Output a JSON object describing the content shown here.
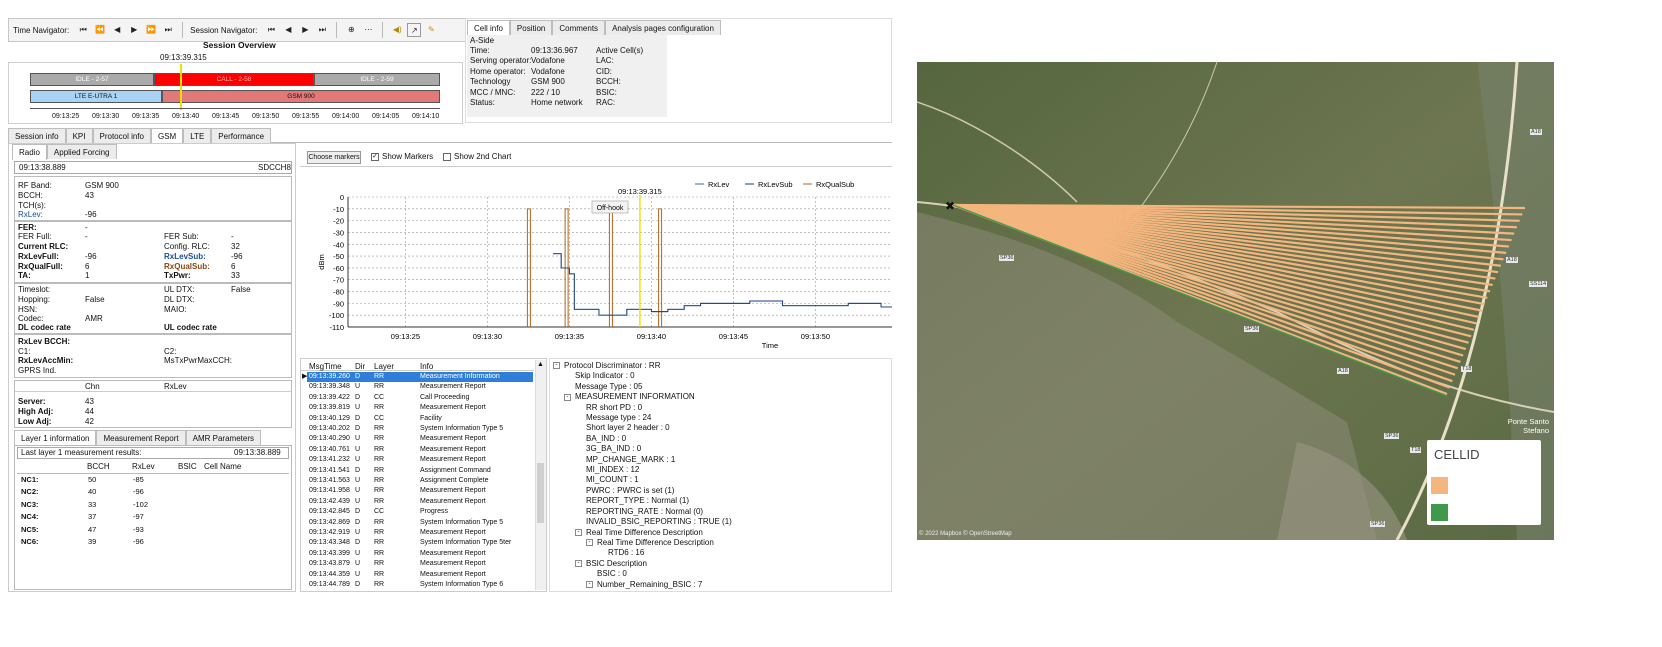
{
  "toolbar": {
    "time_nav_label": "Time Navigator:",
    "session_nav_label": "Session Navigator:",
    "time_nav_icons": [
      "⏮",
      "⏪",
      "◀",
      "▶",
      "⏩",
      "⏭"
    ],
    "session_nav_icons": [
      "⏮",
      "◀",
      "▶",
      "⏭"
    ]
  },
  "session_overview": {
    "title": "Session Overview",
    "cursor_time": "09:13:39.315",
    "segments_row1": [
      "IDLE - 2-57",
      "CALL - 2-58",
      "IDLE - 2-59"
    ],
    "segments_row2": [
      "LTE E-UTRA 1",
      "GSM 900"
    ],
    "axis_ticks": [
      "09:13:25",
      "09:13:30",
      "09:13:35",
      "09:13:40",
      "09:13:45",
      "09:13:50",
      "09:13:55",
      "09:14:00",
      "09:14:05",
      "09:14:10"
    ]
  },
  "cell_info": {
    "tabs": [
      "Cell info",
      "Position",
      "Comments",
      "Analysis pages configuration"
    ],
    "side": "A-Side",
    "rows": [
      [
        "Time:",
        "09:13:36.967",
        "Active Cell(s)"
      ],
      [
        "Serving operator:",
        "Vodafone",
        "LAC:"
      ],
      [
        "Home operator:",
        "Vodafone",
        "CID:"
      ],
      [
        "Technology",
        "GSM 900",
        "BCCH:"
      ],
      [
        "MCC / MNC:",
        "222 / 10",
        "BSIC:"
      ],
      [
        "Status:",
        "Home network",
        "RAC:"
      ]
    ]
  },
  "main_tabs": [
    "Session info",
    "KPI",
    "Protocol info",
    "GSM",
    "LTE",
    "Performance"
  ],
  "sub_tabs": [
    "Radio",
    "Applied Forcing"
  ],
  "radio": {
    "time": "09:13:38.889",
    "channel": "SDCCH8",
    "rf_band_label": "RF Band:",
    "rf_band": "GSM 900",
    "bcch_label": "BCCH:",
    "bcch": "43",
    "tch_label": "TCH(s):",
    "rxlev_label": "RxLev:",
    "rxlev": "-96",
    "fer_label": "FER:",
    "fer": "-",
    "fer_full_label": "FER Full:",
    "fer_full": "-",
    "fer_sub_label": "FER Sub:",
    "fer_sub": "-",
    "current_rlc_label": "Current RLC:",
    "config_rlc_label": "Config. RLC:",
    "config_rlc": "32",
    "rxlevfull_label": "RxLevFull:",
    "rxlevfull": "-96",
    "rxlevsub_label": "RxLevSub:",
    "rxlevsub": "-96",
    "rxqualfull_label": "RxQualFull:",
    "rxqualfull": "6",
    "rxqualsub_label": "RxQualSub:",
    "rxqualsub": "6",
    "ta_label": "TA:",
    "ta": "1",
    "txpwr_label": "TxPwr:",
    "txpwr": "33",
    "timeslot_label": "Timeslot:",
    "ul_dtx_label": "UL DTX:",
    "ul_dtx": "False",
    "hopping_label": "Hopping:",
    "hopping": "False",
    "dl_dtx_label": "DL DTX:",
    "hsn_label": "HSN:",
    "maio_label": "MAIO:",
    "codec_label": "Codec:",
    "codec": "AMR",
    "dl_codec_label": "DL codec rate",
    "ul_codec_label": "UL codec rate",
    "rxlev_bcch_label": "RxLev BCCH:",
    "c1_label": "C1:",
    "c2_label": "C2:",
    "rxlevaccmin_label": "RxLevAccMin:",
    "mstxpwr_label": "MsTxPwrMaxCCH:",
    "gprs_label": "GPRS Ind.",
    "chn_header": "Chn",
    "rxlev_header": "RxLev",
    "server_label": "Server:",
    "server": "43",
    "high_adj_label": "High Adj:",
    "high_adj": "44",
    "low_adj_label": "Low Adj:",
    "low_adj": "42"
  },
  "l1_tabs": [
    "Layer 1 information",
    "Measurement Report",
    "AMR Parameters"
  ],
  "l1": {
    "title": "Last layer 1 measurement results:",
    "time": "09:13:38.889",
    "headers": [
      "",
      "BCCH",
      "RxLev",
      "BSIC",
      "Cell Name"
    ],
    "rows": [
      [
        "NC1:",
        "50",
        "-85"
      ],
      [
        "NC2:",
        "40",
        "-96"
      ],
      [
        "NC3:",
        "33",
        "-102"
      ],
      [
        "NC4:",
        "37",
        "-97"
      ],
      [
        "NC5:",
        "47",
        "-93"
      ],
      [
        "NC6:",
        "39",
        "-96"
      ]
    ]
  },
  "chart_controls": {
    "choose_markers": "Choose markers",
    "show_markers": "Show Markers",
    "show_2nd": "Show 2nd Chart"
  },
  "chart_data": {
    "type": "line",
    "title": "",
    "xlabel": "Time",
    "ylabel": "dBm",
    "ylim": [
      -110,
      0
    ],
    "yticks": [
      0,
      -10,
      -20,
      -30,
      -40,
      -50,
      -60,
      -70,
      -80,
      -90,
      -100,
      -110
    ],
    "xticks": [
      "09:13:25",
      "09:13:30",
      "09:13:35",
      "09:13:40",
      "09:13:45",
      "09:13:50"
    ],
    "xrange_seconds": [
      0,
      37
    ],
    "cursor_time": "09:13:39.315",
    "marker_label": "Off-hook",
    "grid": true,
    "legend_position": "top-right",
    "series": [
      {
        "name": "RxLev",
        "color": "#2e6fb5",
        "points": [
          [
            34,
            -48
          ],
          [
            34.5,
            -60
          ],
          [
            35,
            -65
          ],
          [
            35.3,
            -95
          ],
          [
            36.5,
            -95
          ],
          [
            36.8,
            -100
          ],
          [
            38,
            -100
          ],
          [
            38.5,
            -95
          ],
          [
            40,
            -97
          ],
          [
            41,
            -95
          ],
          [
            42,
            -92
          ],
          [
            43,
            -90
          ],
          [
            46,
            -88
          ],
          [
            48,
            -92
          ],
          [
            52,
            -90
          ],
          [
            54,
            -93
          ],
          [
            56,
            -90
          ]
        ]
      },
      {
        "name": "RxLevSub",
        "color": "#1a3f80",
        "points": [
          [
            34,
            -48
          ],
          [
            34.5,
            -60
          ],
          [
            35,
            -65
          ],
          [
            35.3,
            -95
          ],
          [
            36.5,
            -95
          ],
          [
            36.8,
            -100
          ],
          [
            38,
            -100
          ],
          [
            38.5,
            -95
          ],
          [
            40,
            -97
          ],
          [
            41,
            -95
          ],
          [
            42,
            -92
          ],
          [
            43,
            -90
          ],
          [
            46,
            -88
          ],
          [
            48,
            -92
          ],
          [
            52,
            -90
          ],
          [
            54,
            -93
          ],
          [
            56,
            -90
          ]
        ]
      },
      {
        "name": "RxQualSub",
        "color": "#b5651d",
        "spikes": [
          [
            32.5,
            -10
          ],
          [
            34.8,
            -10
          ],
          [
            37.5,
            -10
          ],
          [
            40.5,
            -10
          ]
        ]
      }
    ]
  },
  "log_table": {
    "headers": [
      "MsgTime",
      "Dir",
      "Layer",
      "Info"
    ],
    "rows": [
      [
        "09:13:39.260",
        "D",
        "RR",
        "Measurement Information"
      ],
      [
        "09:13:39.348",
        "U",
        "RR",
        "Measurement Report"
      ],
      [
        "09:13:39.422",
        "D",
        "CC",
        "Call Proceeding"
      ],
      [
        "09:13:39.819",
        "U",
        "RR",
        "Measurement Report"
      ],
      [
        "09:13:40.129",
        "D",
        "CC",
        "Facility"
      ],
      [
        "09:13:40.202",
        "D",
        "RR",
        "System Information Type 5"
      ],
      [
        "09:13:40.290",
        "U",
        "RR",
        "Measurement Report"
      ],
      [
        "09:13:40.761",
        "U",
        "RR",
        "Measurement Report"
      ],
      [
        "09:13:41.232",
        "U",
        "RR",
        "Measurement Report"
      ],
      [
        "09:13:41.541",
        "D",
        "RR",
        "Assignment Command"
      ],
      [
        "09:13:41.563",
        "U",
        "RR",
        "Assignment Complete"
      ],
      [
        "09:13:41.958",
        "U",
        "RR",
        "Measurement Report"
      ],
      [
        "09:13:42.439",
        "U",
        "RR",
        "Measurement Report"
      ],
      [
        "09:13:42.845",
        "D",
        "CC",
        "Progress"
      ],
      [
        "09:13:42.869",
        "D",
        "RR",
        "System Information Type 5"
      ],
      [
        "09:13:42.919",
        "U",
        "RR",
        "Measurement Report"
      ],
      [
        "09:13:43.348",
        "D",
        "RR",
        "System Information Type 5ter"
      ],
      [
        "09:13:43.399",
        "U",
        "RR",
        "Measurement Report"
      ],
      [
        "09:13:43.879",
        "U",
        "RR",
        "Measurement Report"
      ],
      [
        "09:13:44.359",
        "U",
        "RR",
        "Measurement Report"
      ],
      [
        "09:13:44.789",
        "D",
        "RR",
        "System Information Type 6"
      ]
    ]
  },
  "decode_tree": [
    {
      "indent": 0,
      "toggle": "-",
      "text": "Protocol Discriminator : RR"
    },
    {
      "indent": 1,
      "toggle": "",
      "text": "Skip Indicator : 0"
    },
    {
      "indent": 1,
      "toggle": "",
      "text": "Message Type : 05"
    },
    {
      "indent": 1,
      "toggle": "-",
      "text": "MEASUREMENT INFORMATION"
    },
    {
      "indent": 2,
      "toggle": "",
      "text": "RR short PD : 0"
    },
    {
      "indent": 2,
      "toggle": "",
      "text": "Message type : 24"
    },
    {
      "indent": 2,
      "toggle": "",
      "text": "Short layer 2 header : 0"
    },
    {
      "indent": 2,
      "toggle": "",
      "text": "BA_IND : 0"
    },
    {
      "indent": 2,
      "toggle": "",
      "text": "3G_BA_IND : 0"
    },
    {
      "indent": 2,
      "toggle": "",
      "text": "MP_CHANGE_MARK : 1"
    },
    {
      "indent": 2,
      "toggle": "",
      "text": "MI_INDEX : 12"
    },
    {
      "indent": 2,
      "toggle": "",
      "text": "MI_COUNT : 1"
    },
    {
      "indent": 2,
      "toggle": "",
      "text": "PWRC : PWRC is set (1)"
    },
    {
      "indent": 2,
      "toggle": "",
      "text": "REPORT_TYPE : Normal (1)"
    },
    {
      "indent": 2,
      "toggle": "",
      "text": "REPORTING_RATE : Normal (0)"
    },
    {
      "indent": 2,
      "toggle": "",
      "text": "INVALID_BSIC_REPORTING : TRUE (1)"
    },
    {
      "indent": 2,
      "toggle": "-",
      "text": "Real Time Difference Description"
    },
    {
      "indent": 3,
      "toggle": "-",
      "text": "Real Time Difference Description"
    },
    {
      "indent": 4,
      "toggle": "",
      "text": "RTD6 : 16"
    },
    {
      "indent": 2,
      "toggle": "-",
      "text": "BSIC Description"
    },
    {
      "indent": 3,
      "toggle": "",
      "text": "BSIC : 0"
    },
    {
      "indent": 3,
      "toggle": "-",
      "text": "Number_Remaining_BSIC : 7"
    }
  ],
  "map": {
    "legend_title": "CELLID",
    "legend_colors": [
      "#f4b57e",
      "#3e9a4a"
    ],
    "attribution": "© 2022 Mapbox © OpenStreetMap",
    "road_labels": [
      "SP36",
      "SP36",
      "A18",
      "A18",
      "SS114",
      "SP36",
      "SP36",
      "A18",
      "T18",
      "T18"
    ],
    "place_label": "Ponte Santo Stefano"
  }
}
